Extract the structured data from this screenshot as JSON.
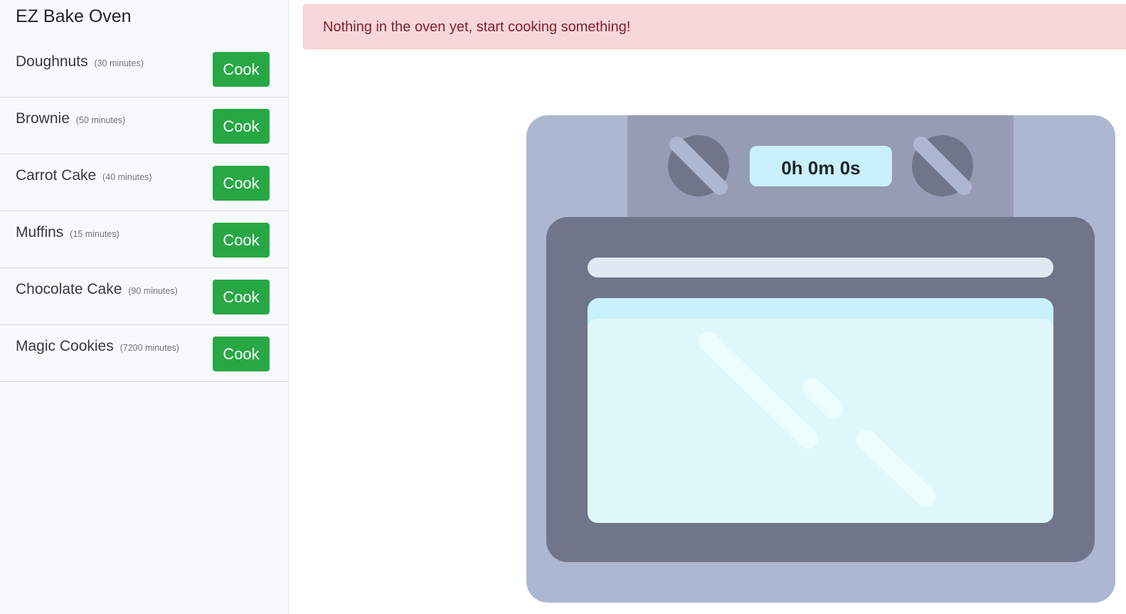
{
  "app": {
    "title": "EZ Bake Oven"
  },
  "recipes": [
    {
      "name": "Doughnuts",
      "time": "(30 minutes)",
      "button": "Cook"
    },
    {
      "name": "Brownie",
      "time": "(50 minutes)",
      "button": "Cook"
    },
    {
      "name": "Carrot Cake",
      "time": "(40 minutes)",
      "button": "Cook"
    },
    {
      "name": "Muffins",
      "time": "(15 minutes)",
      "button": "Cook"
    },
    {
      "name": "Chocolate Cake",
      "time": "(90 minutes)",
      "button": "Cook"
    },
    {
      "name": "Magic Cookies",
      "time": "(7200 minutes)",
      "button": "Cook"
    }
  ],
  "alert": {
    "message": "Nothing in the oven yet, start cooking something!"
  },
  "oven": {
    "timer": "0h 0m 0s"
  },
  "colors": {
    "accent": "#28a745",
    "alert_bg": "#f8d7da",
    "alert_text": "#842029",
    "oven_body": "#adb7d1",
    "oven_panel": "#979cb5",
    "oven_door": "#707589",
    "oven_glass": "#dff7fb"
  }
}
